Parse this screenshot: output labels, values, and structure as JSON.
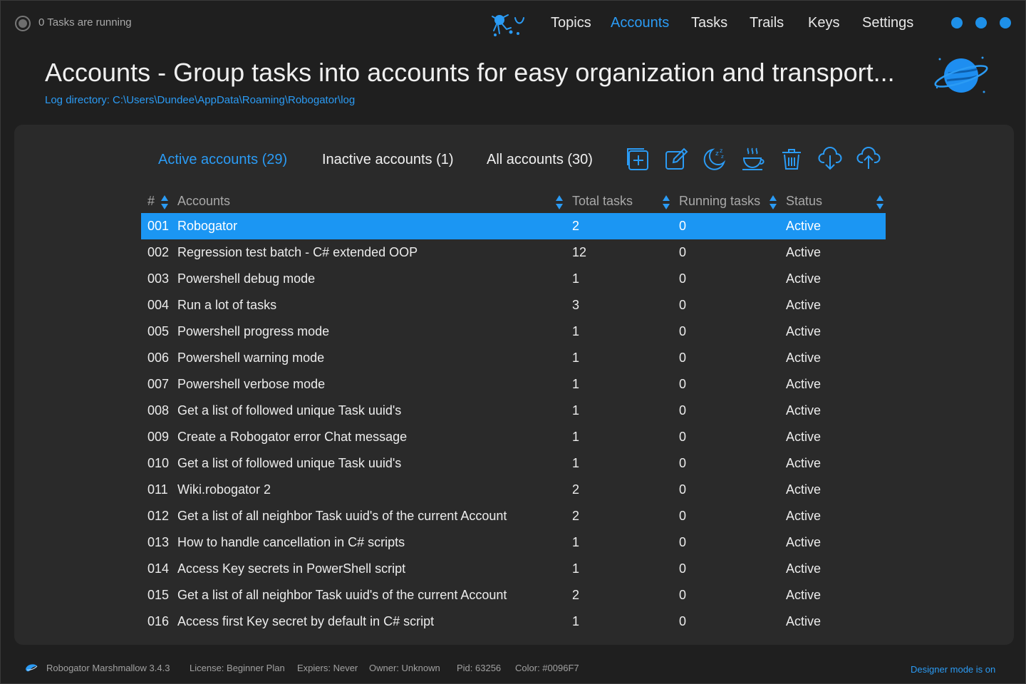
{
  "topbar": {
    "status_text": "0 Tasks are running",
    "nav": [
      "Topics",
      "Accounts",
      "Tasks",
      "Trails",
      "Keys",
      "Settings"
    ],
    "active_nav": "Accounts"
  },
  "header": {
    "title": "Accounts - Group tasks into accounts for easy organization and transport...",
    "log_directory": "Log directory: C:\\Users\\Dundee\\AppData\\Roaming\\Robogator\\log"
  },
  "tabs": {
    "active": "Active accounts (29)",
    "inactive": "Inactive accounts (1)",
    "all": "All accounts (30)"
  },
  "toolbar_icons": [
    "add-icon",
    "edit-icon",
    "sleep-icon",
    "coffee-icon",
    "trash-icon",
    "cloud-download-icon",
    "cloud-upload-icon"
  ],
  "table": {
    "headers": {
      "num": "#",
      "accounts": "Accounts",
      "total": "Total tasks",
      "running": "Running tasks",
      "status": "Status"
    },
    "rows": [
      {
        "num": "001",
        "name": "Robogator",
        "total": "2",
        "running": "0",
        "status": "Active"
      },
      {
        "num": "002",
        "name": "Regression test batch - C# extended OOP",
        "total": "12",
        "running": "0",
        "status": "Active"
      },
      {
        "num": "003",
        "name": "Powershell debug mode",
        "total": "1",
        "running": "0",
        "status": "Active"
      },
      {
        "num": "004",
        "name": "Run a lot of tasks",
        "total": "3",
        "running": "0",
        "status": "Active"
      },
      {
        "num": "005",
        "name": "Powershell progress mode",
        "total": "1",
        "running": "0",
        "status": "Active"
      },
      {
        "num": "006",
        "name": "Powershell warning mode",
        "total": "1",
        "running": "0",
        "status": "Active"
      },
      {
        "num": "007",
        "name": "Powershell verbose mode",
        "total": "1",
        "running": "0",
        "status": "Active"
      },
      {
        "num": "008",
        "name": "Get a list of followed unique Task uuid's",
        "total": "1",
        "running": "0",
        "status": "Active"
      },
      {
        "num": "009",
        "name": "Create a Robogator error Chat message",
        "total": "1",
        "running": "0",
        "status": "Active"
      },
      {
        "num": "010",
        "name": "Get a list of followed unique Task uuid's",
        "total": "1",
        "running": "0",
        "status": "Active"
      },
      {
        "num": "011",
        "name": "Wiki.robogator 2",
        "total": "2",
        "running": "0",
        "status": "Active"
      },
      {
        "num": "012",
        "name": "Get a list of all neighbor Task uuid's of the current Account",
        "total": "2",
        "running": "0",
        "status": "Active"
      },
      {
        "num": "013",
        "name": "How to handle cancellation in C# scripts",
        "total": "1",
        "running": "0",
        "status": "Active"
      },
      {
        "num": "014",
        "name": "Access Key secrets in PowerShell script",
        "total": "1",
        "running": "0",
        "status": "Active"
      },
      {
        "num": "015",
        "name": "Get a list of all neighbor Task uuid's of the current Account",
        "total": "2",
        "running": "0",
        "status": "Active"
      },
      {
        "num": "016",
        "name": "Access first Key secret by default in C# script",
        "total": "1",
        "running": "0",
        "status": "Active"
      }
    ]
  },
  "footer": {
    "app": "Robogator Marshmallow 3.4.3",
    "license": "License: Beginner Plan",
    "expiers": "Expiers: Never",
    "owner": "Owner: Unknown",
    "pid": "Pid: 63256",
    "color": "Color: #0096F7",
    "designer": "Designer mode is on"
  },
  "colors": {
    "accent": "#2b9bf4",
    "selected_row": "#1b96f3",
    "background": "#1f1f1f",
    "panel": "#2a2a2a"
  }
}
